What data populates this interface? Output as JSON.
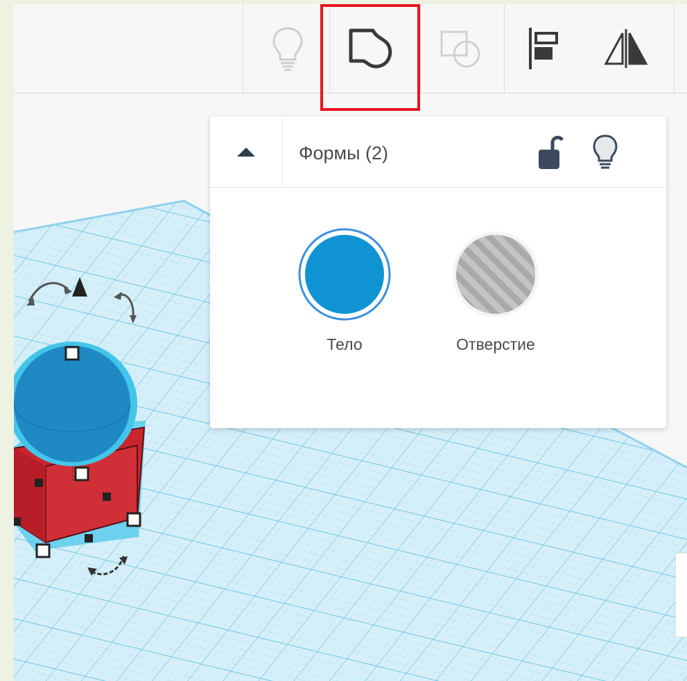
{
  "toolbar": {
    "buttons": [
      {
        "name": "notes-bulb",
        "enabled": false
      },
      {
        "name": "shape-outline",
        "enabled": true,
        "highlighted": true
      },
      {
        "name": "group",
        "enabled": false
      },
      {
        "name": "align",
        "enabled": true
      },
      {
        "name": "mirror",
        "enabled": true
      }
    ]
  },
  "inspector": {
    "title": "Формы (2)",
    "solid_label": "Тело",
    "hole_label": "Отверстие"
  },
  "colors": {
    "highlight": "#e8141b",
    "solid": "#0f93d2",
    "hole": "#b5b5b5",
    "grid": "#8fd1ec",
    "box": "#d12f37",
    "sphere": "#1f89c4"
  },
  "icons": [
    "lightbulb-icon",
    "shape-outline-icon",
    "group-icon",
    "align-icon",
    "mirror-icon",
    "chevron-up-icon",
    "unlock-icon",
    "lightbulb-icon"
  ]
}
